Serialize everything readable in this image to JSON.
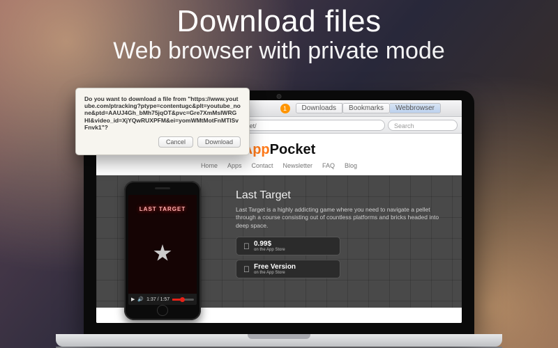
{
  "headline": {
    "title": "Download files",
    "subtitle": "Web browser with private mode"
  },
  "toolbar": {
    "tabs": [
      "Downloads",
      "Bookmarks",
      "Webbrowser"
    ],
    "active_tab": 2,
    "badge": "1"
  },
  "urlbar": {
    "back_glyph": "◀",
    "forward_glyph": "▶",
    "url": "http://www.app-pocket.com/app/last-target/",
    "search_placeholder": "Search"
  },
  "dialog": {
    "lead": "Do you want to download a file from ",
    "url_quoted": "\"https://www.youtube.com/ptracking?ptype=contentugc&plt=youtube_none&ptd=AAUJ4Gh_bMh75jqOT&pvc=Gre7XmMsIWRGHl&video_id=XjYQwRUXPFM&ei=yomWMtMotFnMTlSvFnvk1\"",
    "tail": "?",
    "cancel": "Cancel",
    "download": "Download"
  },
  "site": {
    "logo_a": "App",
    "logo_b": "Pocket",
    "nav": [
      "Home",
      "Apps",
      "Contact",
      "Newsletter",
      "FAQ",
      "Blog"
    ],
    "hero": {
      "title": "Last Target",
      "body": "Last Target is a highly addicting game where you need to navigate a pellet through a course consisting out of countless platforms and bricks headed into deep space.",
      "price_btn": {
        "big": "0.99$",
        "small": "on the App Store"
      },
      "free_btn": {
        "big": "Free Version",
        "small": "on the App Store"
      },
      "game_title": "LAST TARGET",
      "video": {
        "time": "1:37 / 1:57"
      }
    }
  }
}
